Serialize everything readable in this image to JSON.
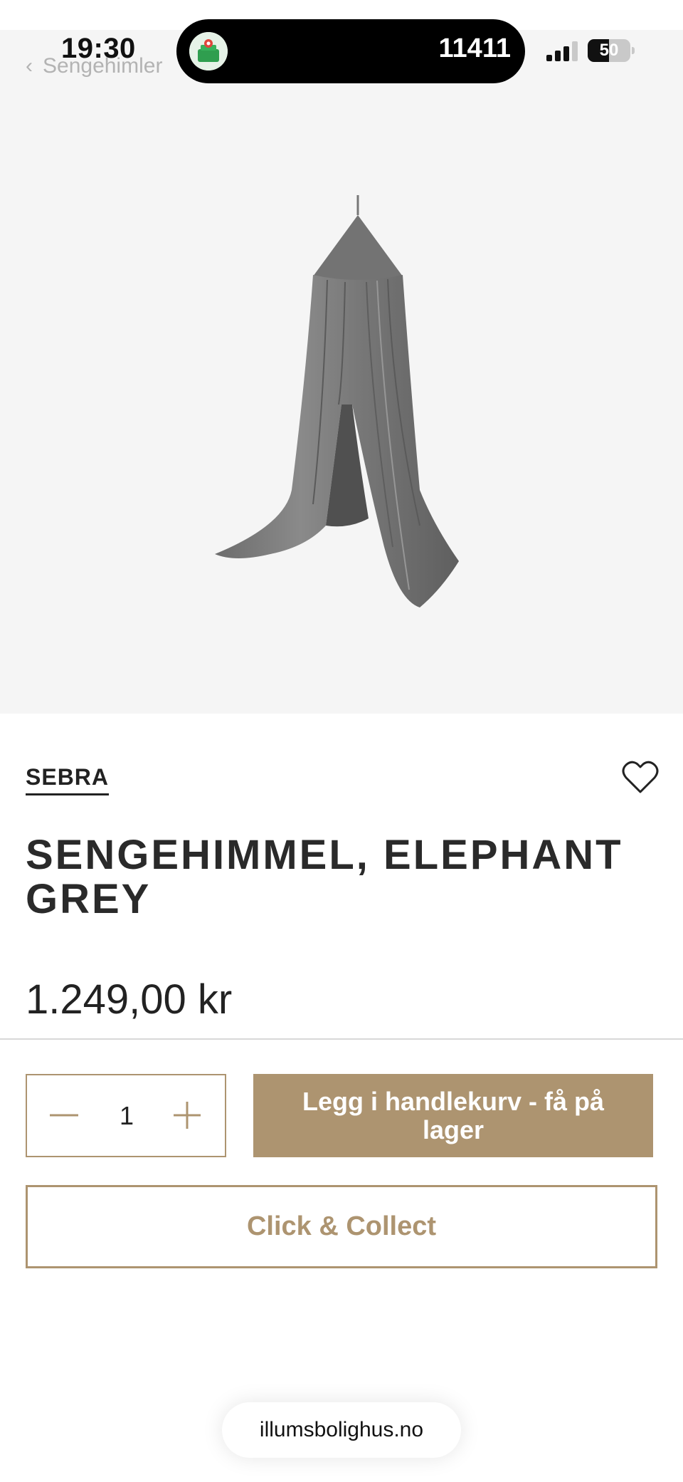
{
  "status_bar": {
    "time": "19:30",
    "island_counter": "11411",
    "battery": "50",
    "battery_level_percent": 50
  },
  "nav": {
    "back_label": "Sengehimler",
    "back_icon": "chevron-left-icon"
  },
  "product": {
    "image_icon": "bed-canopy-image",
    "brand": "SEBRA",
    "title": "SENGEHIMMEL, ELEPHANT GREY",
    "price": "1.249,00 kr",
    "favorite_icon": "heart-icon"
  },
  "purchase": {
    "quantity": "1",
    "minus_icon": "minus-icon",
    "plus_icon": "plus-icon",
    "add_to_cart_label": "Legg i handlekurv - få på lager",
    "click_collect_label": "Click & Collect"
  },
  "browser": {
    "url": "illumsbolighus.no"
  },
  "colors": {
    "accent": "#ad9470",
    "hero_background": "#f5f5f5",
    "text": "#222222"
  }
}
